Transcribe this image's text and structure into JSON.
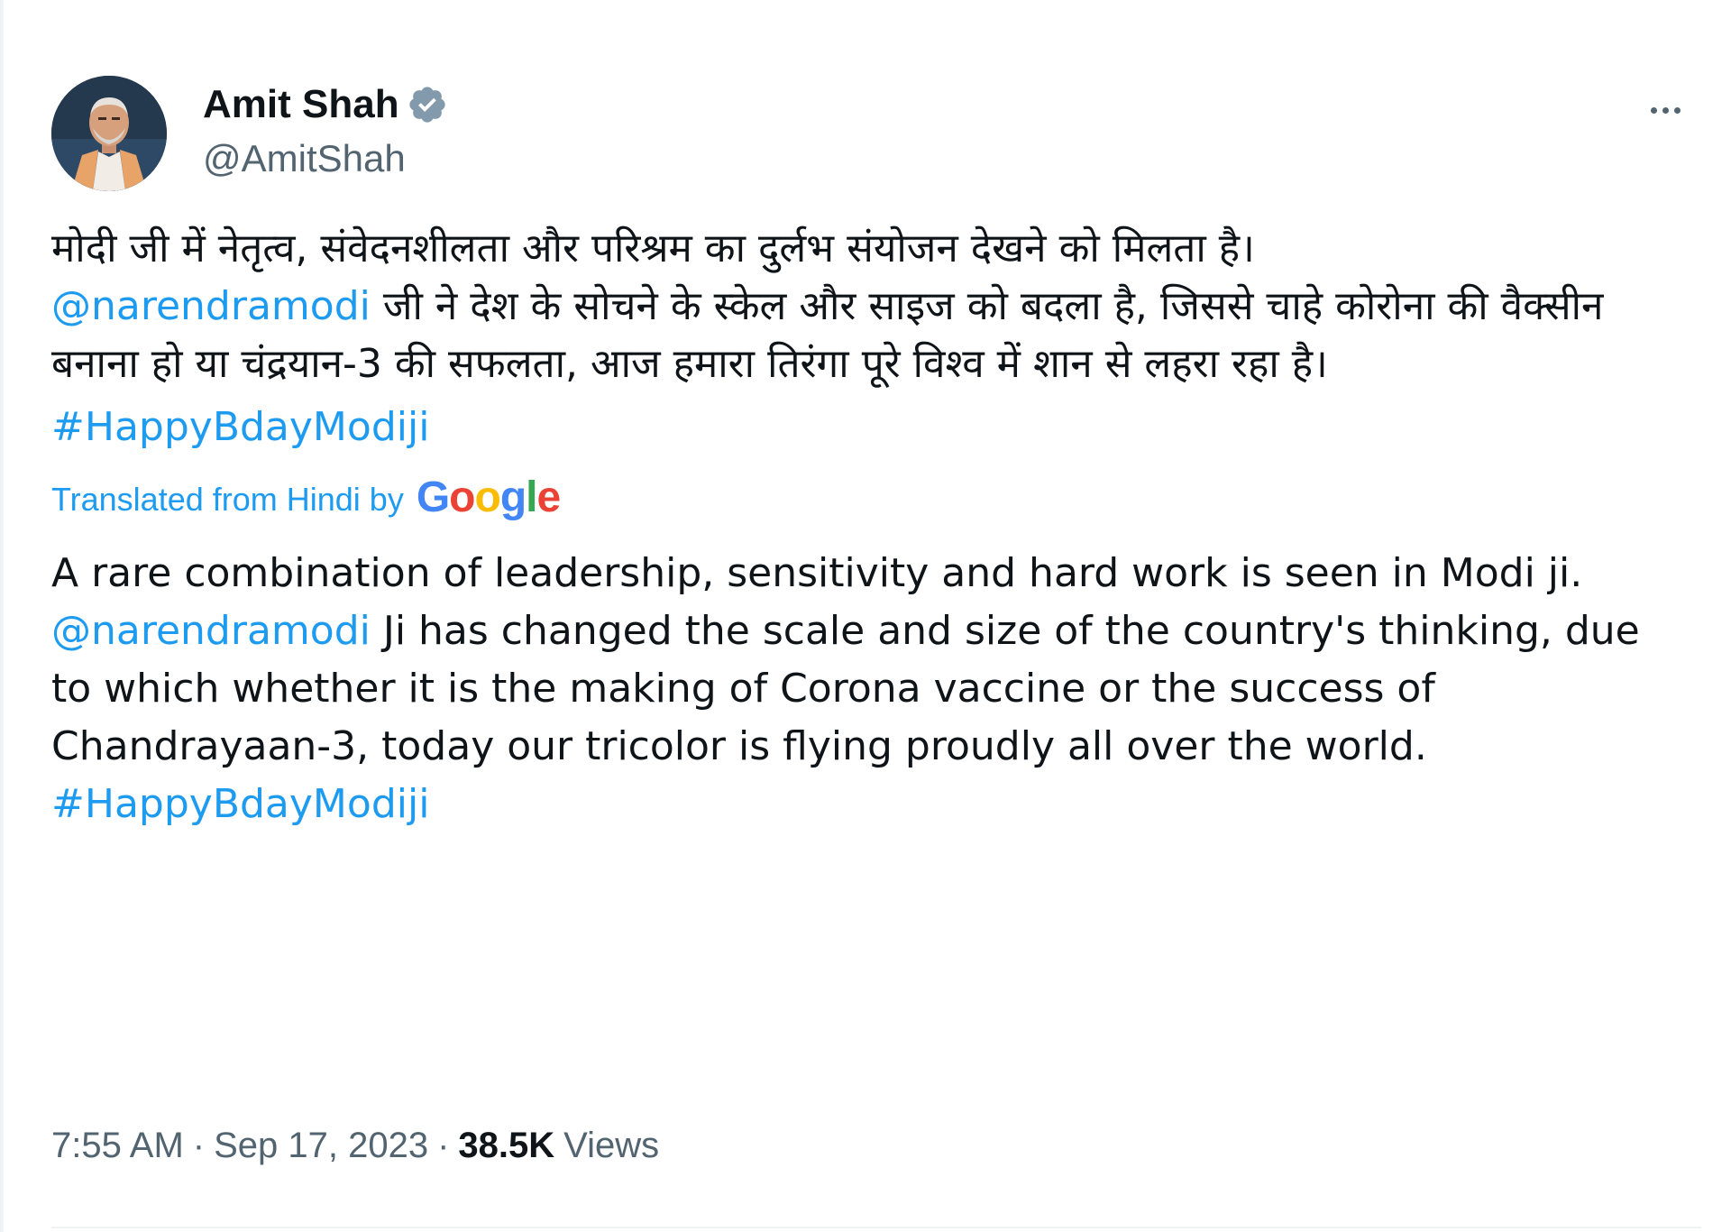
{
  "author": {
    "display_name": "Amit Shah",
    "handle": "@AmitShah",
    "verified_icon": "verified-badge-icon"
  },
  "tweet": {
    "hindi": {
      "line1": "मोदी जी में नेतृत्व, संवेदनशीलता और परिश्रम का दुर्लभ संयोजन देखने को मिलता है।",
      "mention": "@narendramodi",
      "rest": " जी ने देश के सोचने के स्केल और साइज को बदला है, जिससे चाहे कोरोना की वैक्सीन बनाना हो या चंद्रयान-3 की सफलता, आज हमारा तिरंगा पूरे विश्व में शान से लहरा रहा है।",
      "hashtag": "#HappyBdayModiji"
    },
    "translated_label": "Translated from Hindi by",
    "google_logo": "Google",
    "english": {
      "line1": "A rare combination of leadership, sensitivity and hard work is seen in Modi ji.",
      "mention": "@narendramodi",
      "rest": " Ji has changed the scale and size of the country's thinking, due to which whether it is the making of Corona vaccine or the success of Chandrayaan-3, today our tricolor is flying proudly all over the world.",
      "hashtag": "#HappyBdayModiji"
    }
  },
  "meta": {
    "time": "7:55 AM",
    "separator": "·",
    "date": "Sep 17, 2023",
    "views_count": "38.5K",
    "views_label": "Views"
  },
  "colors": {
    "link": "#1d9bf0",
    "secondary_text": "#536471",
    "primary_text": "#0f1419"
  }
}
